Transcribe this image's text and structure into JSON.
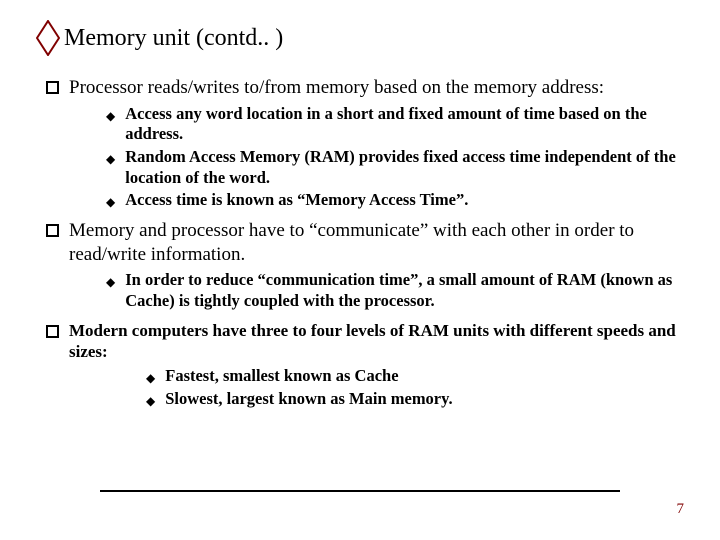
{
  "title": "Memory unit (contd.. )",
  "bullets": {
    "b1": "Processor reads/writes to/from memory based on the memory address:",
    "b1s": {
      "a": "Access any word location in a short and fixed amount of time based on the address.",
      "b": "Random Access Memory (RAM) provides fixed access time independent of the location of the word.",
      "c": "Access time is known as “Memory Access Time”."
    },
    "b2": "Memory and processor have to “communicate” with each other in order to read/write information.",
    "b2s": {
      "a": "In order to reduce “communication time”, a small amount of RAM (known as Cache) is tightly coupled with the processor."
    },
    "b3": "Modern computers have three to four levels of RAM units with different speeds and sizes:",
    "b3s": {
      "a": "Fastest, smallest known as Cache",
      "b": "Slowest, largest known as Main memory."
    }
  },
  "page_number": "7"
}
